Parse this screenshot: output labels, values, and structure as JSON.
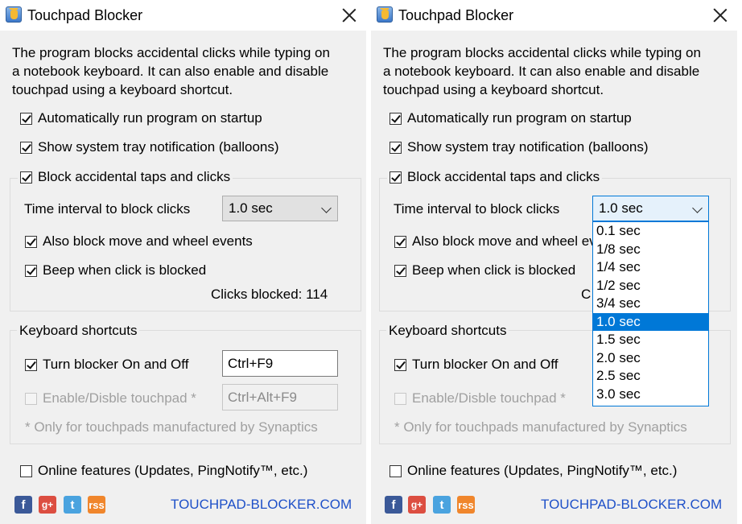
{
  "app": {
    "title": "Touchpad Blocker",
    "description_lines": [
      "The program blocks accidental clicks while typing on",
      "a notebook keyboard. It can also enable and disable",
      "touchpad using a keyboard shortcut."
    ]
  },
  "options": {
    "autorun": "Automatically run program on startup",
    "tray_notification": "Show system tray notification (balloons)",
    "block_taps": "Block accidental taps and clicks",
    "time_interval_label": "Time interval to block clicks",
    "time_interval_value": "1.0 sec",
    "block_move_wheel": "Also block move and wheel events",
    "beep": "Beep when click is blocked",
    "clicks_blocked": "Clicks blocked: 114",
    "clicks_blocked_partial": "C"
  },
  "shortcuts": {
    "group_label": "Keyboard shortcuts",
    "toggle_label": "Turn blocker On and Off",
    "toggle_value": "Ctrl+F9",
    "touchpad_label": "Enable/Disble touchpad *",
    "touchpad_value": "Ctrl+Alt+F9",
    "note": "* Only for touchpads manufactured by Synaptics"
  },
  "online": {
    "label": "Online features (Updates, PingNotify™, etc.)"
  },
  "footer": {
    "website": "TOUCHPAD-BLOCKER.COM",
    "icons": {
      "facebook": "f",
      "google_plus": "g+",
      "twitter": "t",
      "rss": "rss"
    }
  },
  "dropdown": {
    "options": [
      "0.1 sec",
      "1/8 sec",
      "1/4 sec",
      "1/2 sec",
      "3/4 sec",
      "1.0 sec",
      "1.5 sec",
      "2.0 sec",
      "2.5 sec",
      "3.0 sec"
    ],
    "selected_index": 5
  },
  "colors": {
    "accent": "#0078d7",
    "link": "#1e50c8",
    "window_bg": "#f0f0f0"
  }
}
